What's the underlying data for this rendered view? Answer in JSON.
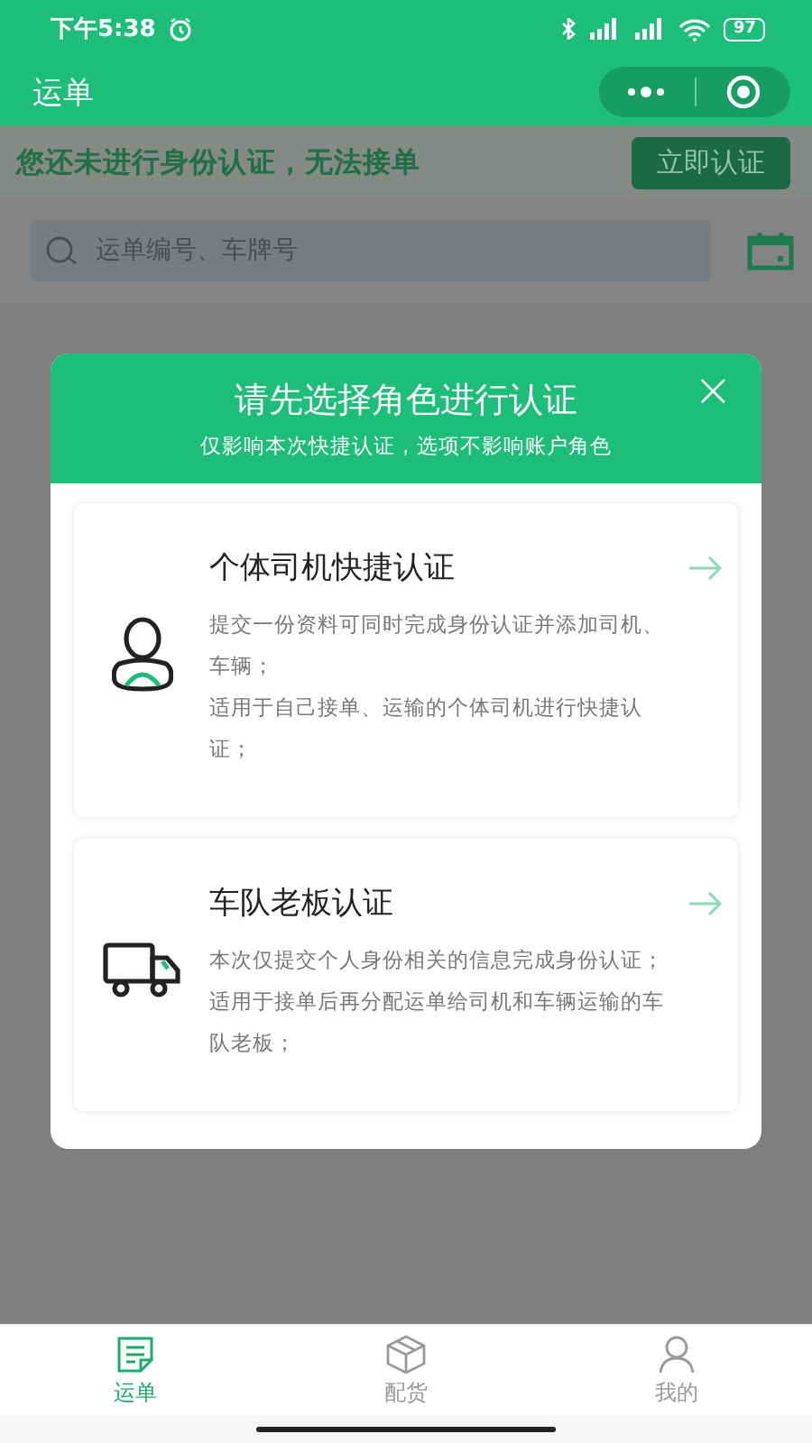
{
  "status_bar": {
    "time": "下午5:38",
    "battery": "97"
  },
  "nav_bar": {
    "title": "运单"
  },
  "notice": {
    "text": "您还未进行身份认证，无法接单",
    "button": "立即认证"
  },
  "search": {
    "placeholder": "运单编号、车牌号"
  },
  "dialog": {
    "title": "请先选择角色进行认证",
    "subtitle": "仅影响本次快捷认证，选项不影响账户角色",
    "close": "×",
    "options": [
      {
        "kind": "driver",
        "title": "个体司机快捷认证",
        "lines": [
          "提交一份资料可同时完成身份认证并添加司机、车辆；",
          "适用于自己接单、运输的个体司机进行快捷认证；"
        ]
      },
      {
        "kind": "fleet",
        "title": "车队老板认证",
        "lines": [
          "本次仅提交个人身份相关的信息完成身份认证；",
          "适用于接单后再分配运单给司机和车辆运输的车队老板；"
        ]
      }
    ]
  },
  "tab_bar": [
    {
      "kind": "waybill",
      "label": "运单",
      "selected": true
    },
    {
      "kind": "box",
      "label": "配货",
      "selected": false
    },
    {
      "kind": "user",
      "label": "我的",
      "selected": false
    }
  ]
}
